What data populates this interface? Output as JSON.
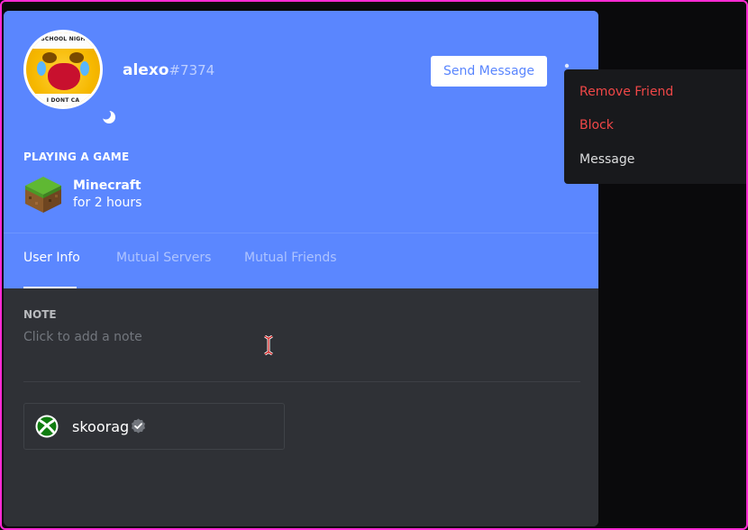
{
  "profile": {
    "username": "alexo",
    "discriminator": "#7374",
    "avatar_caption_top": "SCHOOL NIGH",
    "avatar_caption_bottom": "I DONT CA",
    "status_icon": "moon-icon"
  },
  "header": {
    "send_message_label": "Send Message",
    "more_icon": "kebab-menu-icon"
  },
  "activity": {
    "label": "PLAYING A GAME",
    "game_name": "Minecraft",
    "duration": "for 2 hours",
    "game_icon": "minecraft-grass-block-icon"
  },
  "tabs": [
    {
      "label": "User Info",
      "active": true
    },
    {
      "label": "Mutual Servers",
      "active": false
    },
    {
      "label": "Mutual Friends",
      "active": false
    }
  ],
  "note": {
    "label": "NOTE",
    "placeholder": "Click to add a note"
  },
  "connected_account": {
    "platform_icon": "xbox-icon",
    "name": "skoorag",
    "verified_icon": "verified-check-icon"
  },
  "context_menu": {
    "items": [
      {
        "label": "Remove Friend",
        "variant": "danger"
      },
      {
        "label": "Block",
        "variant": "danger"
      },
      {
        "label": "Message",
        "variant": "normal"
      }
    ]
  },
  "colors": {
    "blurple": "#5a86fe",
    "danger": "#f04747",
    "background_dark": "#2f3136",
    "menu_bg": "#18191c",
    "frame_border": "#ff2ad4"
  }
}
